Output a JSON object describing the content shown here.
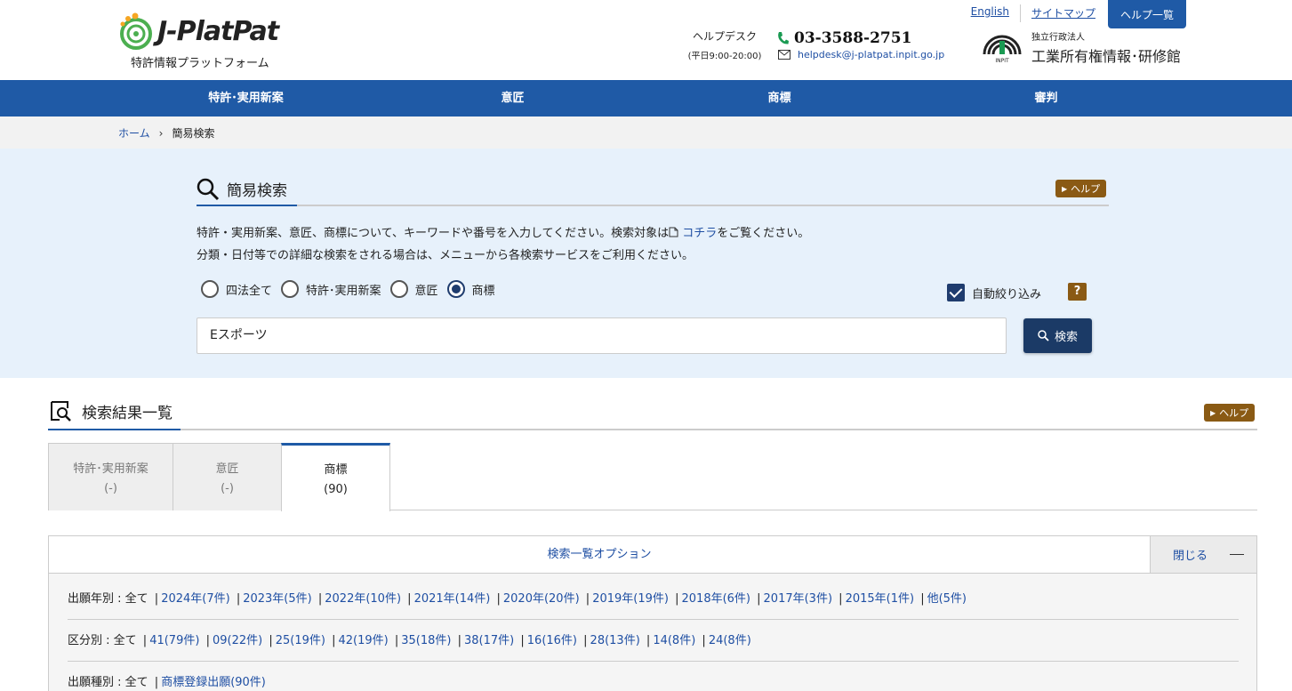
{
  "brand": {
    "name": "J-PlatPat",
    "subtitle": "特許情報プラットフォーム",
    "colors": {
      "primary": "#1f5aa6",
      "dark": "#1b3a66",
      "help": "#8a5a14"
    }
  },
  "toplinks": {
    "english": "English",
    "sitemap": "サイトマップ",
    "helplist": "ヘルプ一覧"
  },
  "helpdesk": {
    "label": "ヘルプデスク",
    "hours": "(平日9:00-20:00)",
    "phone": "03-3588-2751",
    "email": "helpdesk@j-platpat.inpit.go.jp"
  },
  "inpit": {
    "small": "独立行政法人",
    "name": "工業所有権情報･研修館",
    "mark": "INPIT"
  },
  "nav": [
    "特許･実用新案",
    "意匠",
    "商標",
    "審判"
  ],
  "breadcrumb": {
    "home": "ホーム",
    "current": "簡易検索"
  },
  "simple_search": {
    "title": "簡易検索",
    "help": "ヘルプ",
    "desc1_pre": "特許・実用新案、意匠、商標について、キーワードや番号を入力してください。検索対象は",
    "desc1_link": "コチラ",
    "desc1_post": "をご覧ください。",
    "desc2": "分類・日付等での詳細な検索をされる場合は、メニューから各検索サービスをご利用ください。",
    "radios": [
      {
        "label": "四法全て",
        "checked": false
      },
      {
        "label": "特許･実用新案",
        "checked": false
      },
      {
        "label": "意匠",
        "checked": false
      },
      {
        "label": "商標",
        "checked": true
      }
    ],
    "auto_filter": "自動絞り込み",
    "auto_filter_checked": true,
    "question": "?",
    "query": "Eスポーツ",
    "search_button": "検索"
  },
  "results": {
    "title": "検索結果一覧",
    "help": "ヘルプ",
    "tabs": [
      {
        "name": "特許･実用新案",
        "count": "(-)"
      },
      {
        "name": "意匠",
        "count": "(-)"
      },
      {
        "name": "商標",
        "count": "(90)"
      }
    ]
  },
  "options": {
    "title": "検索一覧オプション",
    "close": "閉じる",
    "rows": [
      {
        "label": "出願年別 : 全て",
        "items": [
          "2024年(7件)",
          "2023年(5件)",
          "2022年(10件)",
          "2021年(14件)",
          "2020年(20件)",
          "2019年(19件)",
          "2018年(6件)",
          "2017年(3件)",
          "2015年(1件)",
          "他(5件)"
        ]
      },
      {
        "label": "区分別 : 全て",
        "items": [
          "41(79件)",
          "09(22件)",
          "25(19件)",
          "42(19件)",
          "35(18件)",
          "38(17件)",
          "16(16件)",
          "28(13件)",
          "14(8件)",
          "24(8件)"
        ]
      },
      {
        "label": "出願種別 : 全て",
        "items": [
          "商標登録出願(90件)"
        ]
      }
    ]
  }
}
